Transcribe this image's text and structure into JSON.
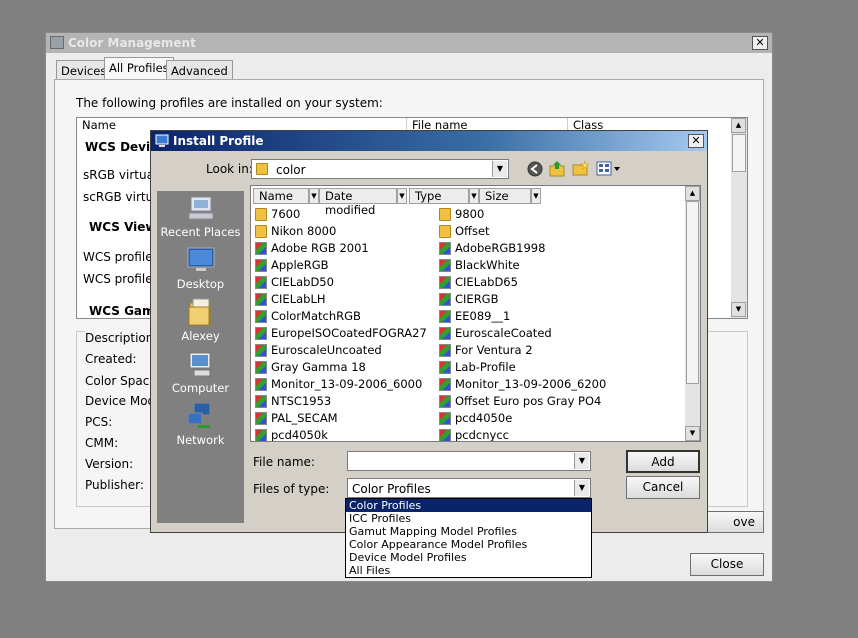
{
  "color_mgmt": {
    "title": "Color Management",
    "tabs": [
      "Devices",
      "All Profiles",
      "Advanced"
    ],
    "intro": "The following profiles are installed on your system:",
    "list_headers": [
      "Name",
      "File name",
      "Class"
    ],
    "list_rows": [
      {
        "text": "WCS Device",
        "bold": true
      },
      {
        "text": "sRGB virtual",
        "bold": false
      },
      {
        "text": "scRGB virtua",
        "bold": false
      },
      {
        "text": "WCS Viewi",
        "bold": true
      },
      {
        "text": "WCS profile",
        "bold": false
      },
      {
        "text": "WCS profile",
        "bold": false
      },
      {
        "text": "WCS Gamu",
        "bold": true
      }
    ],
    "desc_title": "Description",
    "desc_labels": [
      "Created:",
      "Color Space:",
      "Device Model:",
      "PCS:",
      "CMM:",
      "Version:",
      "Publisher:"
    ],
    "remove_label": "ove",
    "close_label": "Close"
  },
  "install": {
    "title": "Install Profile",
    "look_in_label": "Look in:",
    "look_in_value": "color",
    "places": [
      "Recent Places",
      "Desktop",
      "Alexey",
      "Computer",
      "Network"
    ],
    "columns": [
      "Name",
      "Date modified",
      "Type",
      "Size"
    ],
    "files_col1": [
      {
        "name": "7600",
        "type": "folder"
      },
      {
        "name": "Nikon 8000",
        "type": "folder"
      },
      {
        "name": "Adobe RGB 2001",
        "type": "profile"
      },
      {
        "name": "AppleRGB",
        "type": "profile"
      },
      {
        "name": "CIELabD50",
        "type": "profile"
      },
      {
        "name": "CIELabLH",
        "type": "profile"
      },
      {
        "name": "ColorMatchRGB",
        "type": "profile"
      },
      {
        "name": "EuropeISOCoatedFOGRA27",
        "type": "profile"
      },
      {
        "name": "EuroscaleUncoated",
        "type": "profile"
      },
      {
        "name": "Gray Gamma 18",
        "type": "profile"
      },
      {
        "name": "Monitor_13-09-2006_6000",
        "type": "profile"
      },
      {
        "name": "NTSC1953",
        "type": "profile"
      },
      {
        "name": "PAL_SECAM",
        "type": "profile"
      },
      {
        "name": "pcd4050k",
        "type": "profile"
      }
    ],
    "files_col2": [
      {
        "name": "9800",
        "type": "folder"
      },
      {
        "name": "Offset",
        "type": "folder"
      },
      {
        "name": "AdobeRGB1998",
        "type": "profile"
      },
      {
        "name": "BlackWhite",
        "type": "profile"
      },
      {
        "name": "CIELabD65",
        "type": "profile"
      },
      {
        "name": "CIERGB",
        "type": "profile"
      },
      {
        "name": "EE089__1",
        "type": "profile"
      },
      {
        "name": "EuroscaleCoated",
        "type": "profile"
      },
      {
        "name": "For Ventura 2",
        "type": "profile"
      },
      {
        "name": "Lab-Profile",
        "type": "profile"
      },
      {
        "name": "Monitor_13-09-2006_6200",
        "type": "profile"
      },
      {
        "name": "Offset Euro pos Gray PO4",
        "type": "profile"
      },
      {
        "name": "pcd4050e",
        "type": "profile"
      },
      {
        "name": "pcdcnycc",
        "type": "profile"
      }
    ],
    "file_name_label": "File name:",
    "file_name_value": "",
    "files_of_type_label": "Files of type:",
    "files_of_type_value": "Color Profiles",
    "type_options": [
      "Color Profiles",
      "ICC Profiles",
      "Gamut Mapping Model Profiles",
      "Color Appearance Model Profiles",
      "Device Model Profiles",
      "All Files"
    ],
    "add_label": "Add",
    "cancel_label": "Cancel"
  }
}
